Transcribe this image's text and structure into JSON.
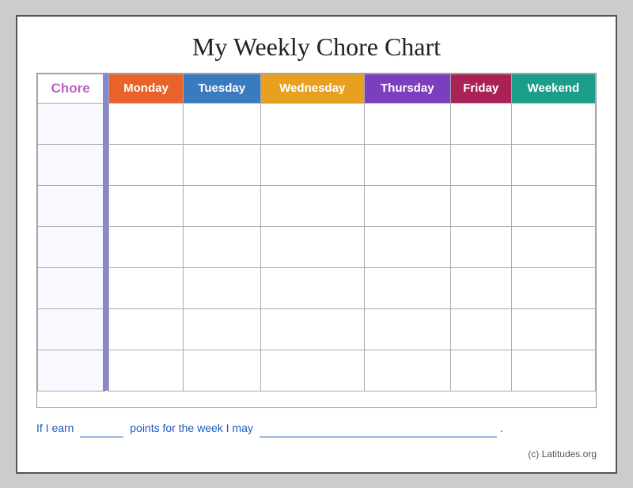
{
  "page": {
    "title": "My Weekly Chore Chart",
    "columns": {
      "chore": "Chore",
      "monday": "Monday",
      "tuesday": "Tuesday",
      "wednesday": "Wednesday",
      "thursday": "Thursday",
      "friday": "Friday",
      "weekend": "Weekend"
    },
    "rows_count": 7,
    "footer": {
      "text_before_blank1": "If I earn",
      "text_between": "points for the week I may",
      "period": "."
    },
    "copyright": "(c) Latitudes.org"
  }
}
